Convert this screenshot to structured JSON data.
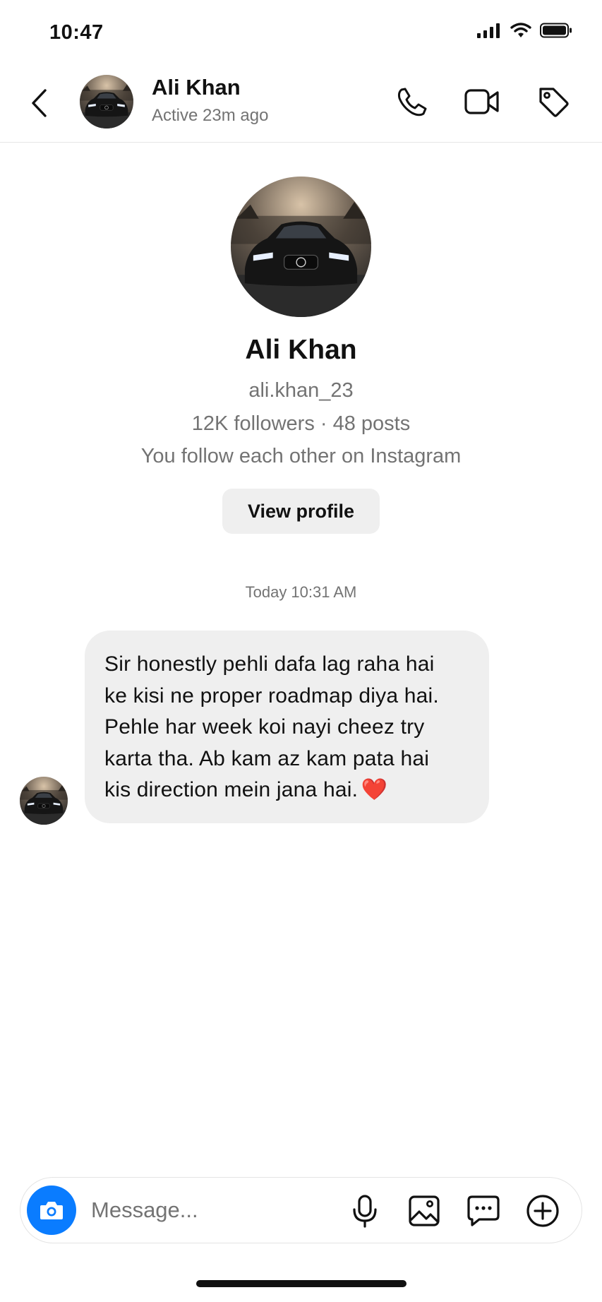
{
  "status_bar": {
    "time": "10:47",
    "icons": [
      "signal-icon",
      "wifi-icon",
      "battery-icon"
    ]
  },
  "header": {
    "name": "Ali Khan",
    "status": "Active 23m ago",
    "actions": [
      "phone-icon",
      "video-camera-icon",
      "tag-icon"
    ]
  },
  "profile": {
    "name": "Ali Khan",
    "username": "ali.khan_23",
    "stats": "12K followers · 48 posts",
    "mutual": "You follow each other on Instagram",
    "view_profile_label": "View profile"
  },
  "conversation": {
    "timestamp": "Today 10:31 AM",
    "messages": [
      {
        "sender": "Ali Khan",
        "text": "Sir honestly pehli dafa lag raha hai\nke kisi ne proper roadmap diya hai.\nPehle har week koi nayi cheez try\nkarta tha. Ab kam az kam pata hai\nkis direction mein jana hai.",
        "emoji": "❤️"
      }
    ]
  },
  "composer": {
    "placeholder": "Message...",
    "icons": [
      "camera-icon",
      "microphone-icon",
      "gallery-icon",
      "sticker-icon",
      "plus-icon"
    ]
  },
  "colors": {
    "accent": "#0a7cff",
    "bubble": "#efefef",
    "secondary_text": "#737373"
  }
}
